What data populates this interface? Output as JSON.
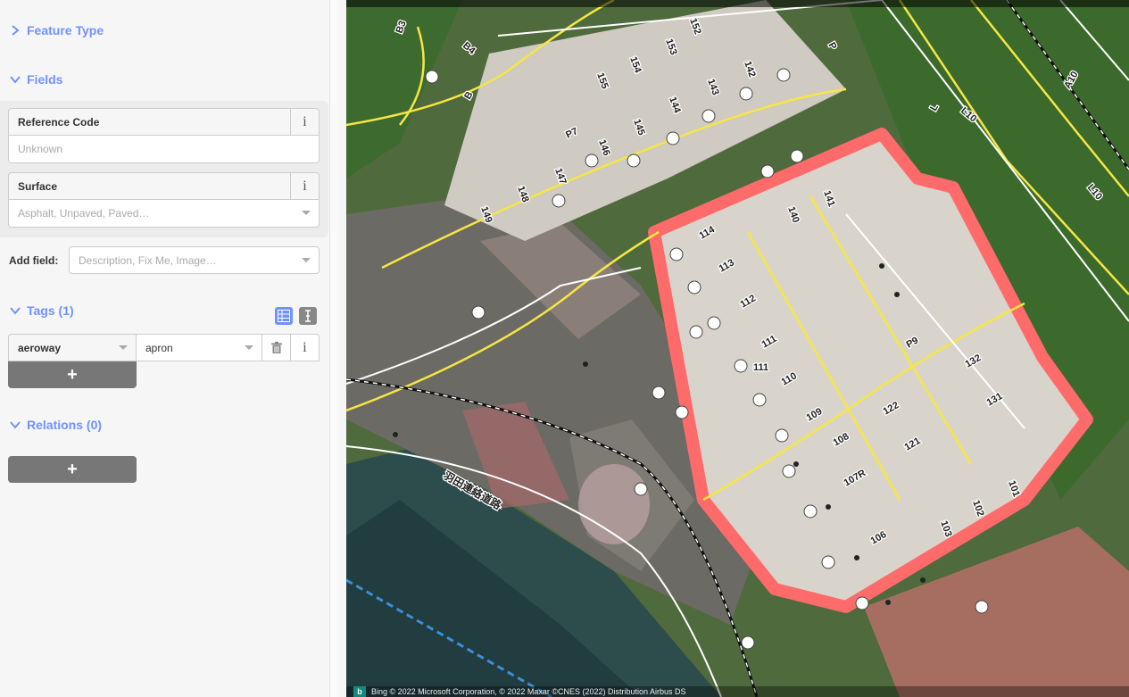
{
  "sidebar": {
    "feature_type": {
      "label": "Feature Type",
      "expanded": false
    },
    "fields": {
      "label": "Fields",
      "expanded": true,
      "items": [
        {
          "label": "Reference Code",
          "placeholder": "Unknown",
          "info": "i"
        },
        {
          "label": "Surface",
          "placeholder": "Asphalt, Unpaved, Paved…",
          "info": "i"
        }
      ],
      "add_field_label": "Add field:",
      "add_field_placeholder": "Description, Fix Me, Image…"
    },
    "tags": {
      "label": "Tags (1)",
      "expanded": true,
      "rows": [
        {
          "key": "aeroway",
          "value": "apron",
          "info": "i"
        }
      ],
      "add_label": "+"
    },
    "relations": {
      "label": "Relations (0)",
      "expanded": true,
      "add_label": "+"
    }
  },
  "map": {
    "attribution": "Bing   © 2022 Microsoft Corporation, © 2022 Maxar ©CNES (2022) Distribution Airbus DS",
    "road_label": "羽田連絡道路",
    "taxiway_labels": [
      "B3",
      "B4",
      "B",
      "P7",
      "P",
      "P9",
      "L10",
      "L10",
      "A10",
      "L"
    ],
    "stand_labels": [
      "152",
      "153",
      "154",
      "155",
      "142",
      "143",
      "144",
      "145",
      "146",
      "147",
      "148",
      "149",
      "141",
      "140",
      "114",
      "113",
      "112",
      "111",
      "111",
      "110",
      "109",
      "108",
      "107R",
      "106",
      "103",
      "102",
      "101",
      "121",
      "122",
      "131",
      "132"
    ],
    "colors": {
      "selected_outline": "#ff6b6b",
      "taxiway": "#f5e642",
      "apron": "#d7d2c8",
      "grass": "#3f6b2b"
    }
  }
}
